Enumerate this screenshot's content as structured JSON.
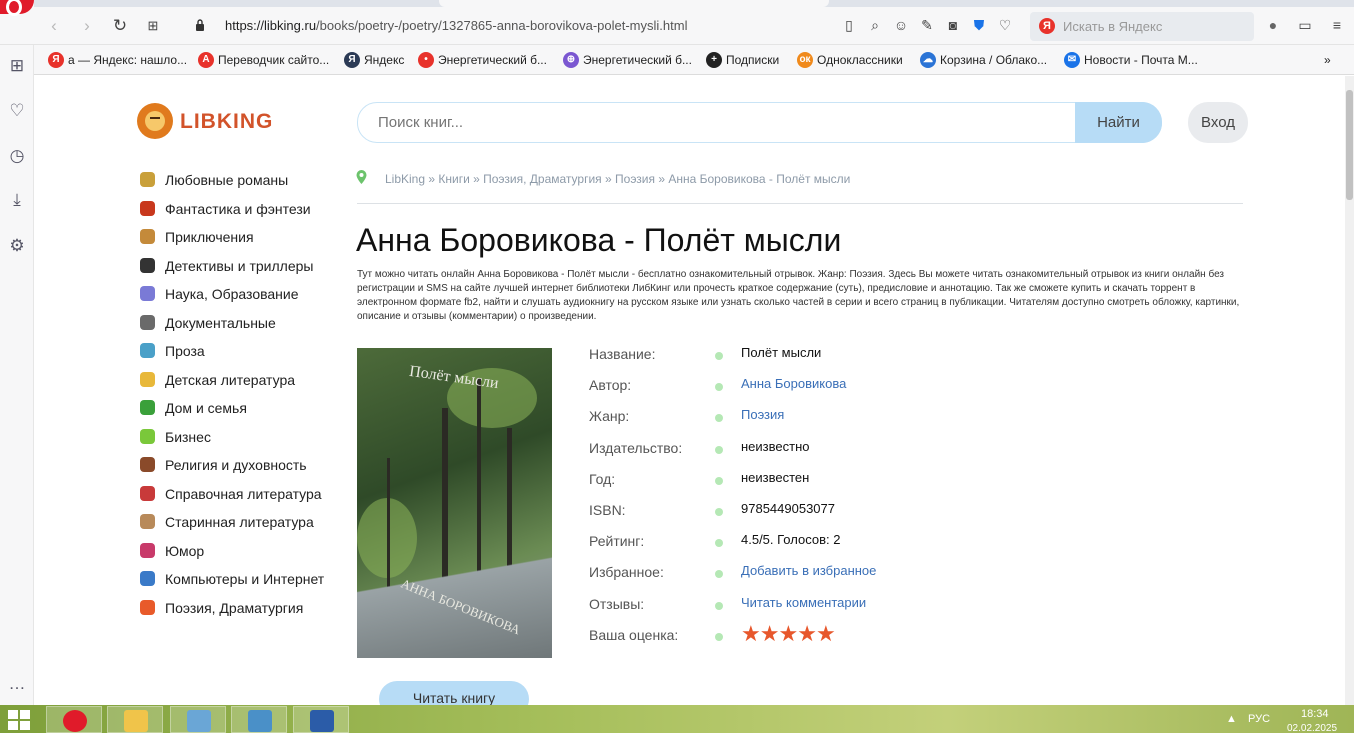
{
  "browser": {
    "url_domain": "https://libking.ru",
    "url_path": "/books/poetry-/poetry/1327865-anna-borovikova-polet-mysli.html",
    "search_placeholder": "Искать в Яндекс",
    "search_logo": "Я"
  },
  "bookmarks": [
    {
      "label": "а — Яндекс: нашло...",
      "icon": "yandex-icon",
      "color": "#e8322b",
      "glyph": "Я"
    },
    {
      "label": "Переводчик сайто...",
      "icon": "translate-icon",
      "color": "#e8322b",
      "glyph": "A"
    },
    {
      "label": "Яндекс",
      "icon": "yandex-browser-icon",
      "color": "#2b3a55",
      "glyph": "Я"
    },
    {
      "label": "Энергетический б...",
      "icon": "map-pin-icon",
      "color": "#e8322b",
      "glyph": "•"
    },
    {
      "label": "Энергетический б...",
      "icon": "globe-icon",
      "color": "#7b57d1",
      "glyph": "⊕"
    },
    {
      "label": "Подписки",
      "icon": "plus-icon",
      "color": "#222222",
      "glyph": "+"
    },
    {
      "label": "Одноклассники",
      "icon": "ok-icon",
      "color": "#f08a1c",
      "glyph": "ок"
    },
    {
      "label": "Корзина / Облако...",
      "icon": "cloud-icon",
      "color": "#2b74d6",
      "glyph": "☁"
    },
    {
      "label": "Новости - Почта М...",
      "icon": "mail-icon",
      "color": "#1a73e8",
      "glyph": "✉"
    }
  ],
  "site": {
    "logo": "LIBKING",
    "search_placeholder": "Поиск книг...",
    "search_button": "Найти",
    "login_button": "Вход"
  },
  "categories": [
    {
      "label": "Любовные романы",
      "color": "#c9a03a"
    },
    {
      "label": "Фантастика и фэнтези",
      "color": "#c8381d"
    },
    {
      "label": "Приключения",
      "color": "#c48a3a"
    },
    {
      "label": "Детективы и триллеры",
      "color": "#333333"
    },
    {
      "label": "Наука, Образование",
      "color": "#7a7ad6"
    },
    {
      "label": "Документальные",
      "color": "#6a6a6a"
    },
    {
      "label": "Проза",
      "color": "#4aa0c8"
    },
    {
      "label": "Детская литература",
      "color": "#e8b83a"
    },
    {
      "label": "Дом и семья",
      "color": "#3aa03a"
    },
    {
      "label": "Бизнес",
      "color": "#7ac83a"
    },
    {
      "label": "Религия и духовность",
      "color": "#8a4a2a"
    },
    {
      "label": "Справочная литература",
      "color": "#c83a3a"
    },
    {
      "label": "Старинная литература",
      "color": "#b88a5a"
    },
    {
      "label": "Юмор",
      "color": "#c83a6a"
    },
    {
      "label": "Компьютеры и Интернет",
      "color": "#3a7ac8"
    },
    {
      "label": "Поэзия, Драматургия",
      "color": "#e85a2a"
    }
  ],
  "breadcrumb": [
    "LibKing",
    "Книги",
    "Поэзия, Драматургия",
    "Поэзия",
    "Анна Боровикова - Полёт мысли"
  ],
  "page_title": "Анна Боровикова - Полёт мысли",
  "description": "Тут можно читать онлайн Анна Боровикова - Полёт мысли - бесплатно ознакомительный отрывок. Жанр: Поэзия. Здесь Вы можете читать ознакомительный отрывок из книги онлайн без регистрации и SMS на сайте лучшей интернет библиотеки ЛибКинг или прочесть краткое содержание (суть), предисловие и аннотацию. Так же сможете купить и скачать торрент в электронном формате fb2, найти и слушать аудиокнигу на русском языке или узнать сколько частей в серии и всего страниц в публикации. Читателям доступно смотреть обложку, картинки, описание и отзывы (комментарии) о произведении.",
  "cover": {
    "title": "Полёт мысли",
    "author": "АННА БОРОВИКОВА"
  },
  "book_info": [
    {
      "label": "Название:",
      "value": "Полёт мысли",
      "link": false
    },
    {
      "label": "Автор:",
      "value": "Анна Боровикова",
      "link": true
    },
    {
      "label": "Жанр:",
      "value": "Поэзия",
      "link": true
    },
    {
      "label": "Издательство:",
      "value": "неизвестно",
      "link": false
    },
    {
      "label": "Год:",
      "value": "неизвестен",
      "link": false
    },
    {
      "label": "ISBN:",
      "value": "9785449053077",
      "link": false
    },
    {
      "label": "Рейтинг:",
      "value": "4.5/5. Голосов: 2",
      "link": false
    },
    {
      "label": "Избранное:",
      "value": "Добавить в избранное",
      "link": true
    },
    {
      "label": "Отзывы:",
      "value": "Читать комментарии",
      "link": true
    }
  ],
  "rating": {
    "label": "Ваша оценка:",
    "stars": 5,
    "max": 5
  },
  "read_button": "Читать книгу",
  "taskbar": {
    "lang": "РУС",
    "time": "18:34",
    "date": "02.02.2025"
  }
}
